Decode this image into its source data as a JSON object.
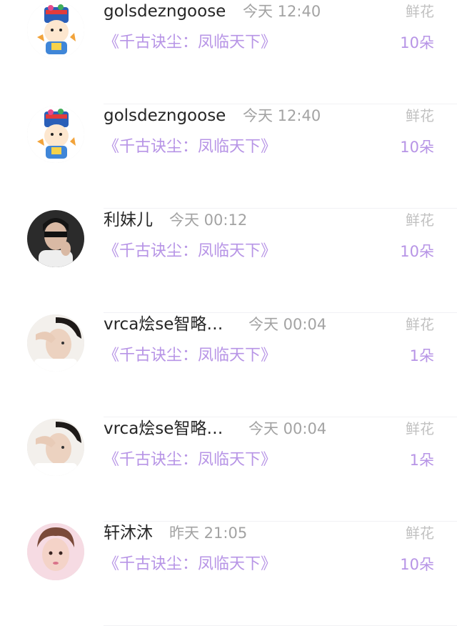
{
  "colors": {
    "accent": "#b794e6",
    "name_text": "#262626",
    "meta_text": "#a3a3a3",
    "divider": "#f1f1f4"
  },
  "gift_list": [
    {
      "username": "golsdezngoose",
      "time": "今天 12:40",
      "book": "《千古诀尘：凤临天下》",
      "gift_label": "鲜花",
      "gift_count": "10朵",
      "avatar": "cartoon-costume-avatar"
    },
    {
      "username": "golsdezngoose",
      "time": "今天 12:40",
      "book": "《千古诀尘：凤临天下》",
      "gift_label": "鲜花",
      "gift_count": "10朵",
      "avatar": "cartoon-costume-avatar"
    },
    {
      "username": "利妹儿",
      "time": "今天 00:12",
      "book": "《千古诀尘：凤临天下》",
      "gift_label": "鲜花",
      "gift_count": "10朵",
      "avatar": "dark-portrait-avatar"
    },
    {
      "username": "vrca烩se智略…",
      "time": "今天 00:04",
      "book": "《千古诀尘：凤临天下》",
      "gift_label": "鲜花",
      "gift_count": "1朵",
      "avatar": "light-portrait-avatar"
    },
    {
      "username": "vrca烩se智略…",
      "time": "今天 00:04",
      "book": "《千古诀尘：凤临天下》",
      "gift_label": "鲜花",
      "gift_count": "1朵",
      "avatar": "light-portrait-avatar"
    },
    {
      "username": "轩沐沐",
      "time": "昨天 21:05",
      "book": "《千古诀尘：凤临天下》",
      "gift_label": "鲜花",
      "gift_count": "10朵",
      "avatar": "pink-portrait-avatar"
    }
  ]
}
